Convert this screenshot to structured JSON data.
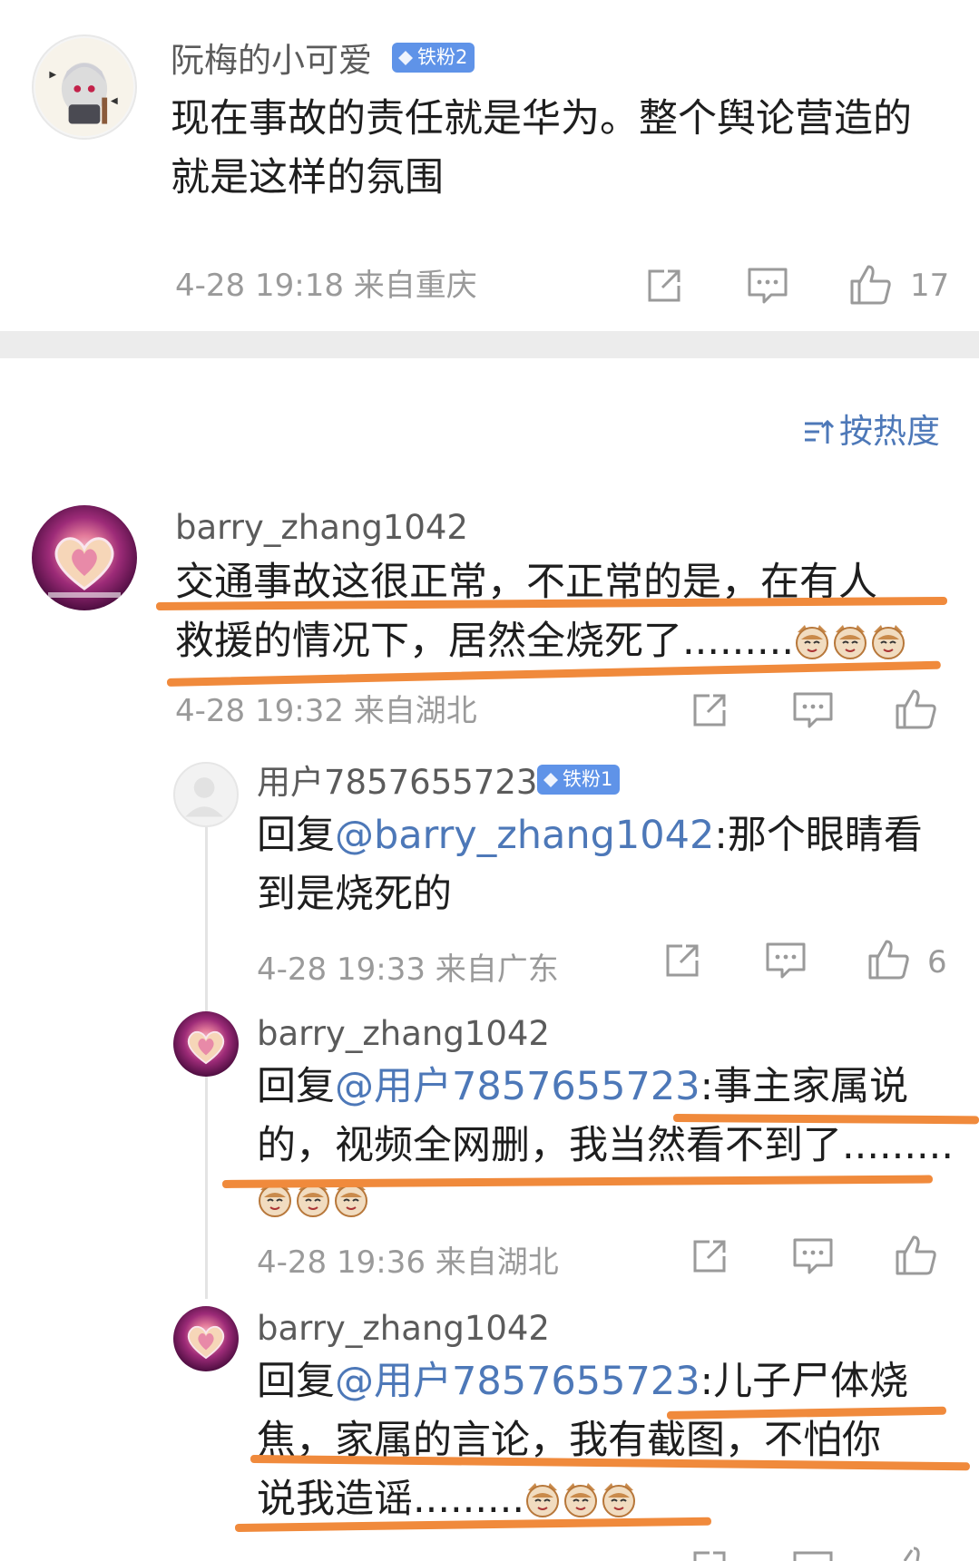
{
  "top_comment": {
    "username": "阮梅的小可爱",
    "badge": "铁粉2",
    "text_line1": "现在事故的责任就是华为。整个舆论营造的",
    "text_line2": "就是这样的氛围",
    "time_location": "4-28 19:18 来自重庆",
    "like_count": "17"
  },
  "sort_label": "按热度",
  "comment": {
    "username": "barry_zhang1042",
    "text_line1": "交通事故这很正常，不正常的是，在有人",
    "text_line2": "救援的情况下，居然全烧死了.........",
    "time_location": "4-28 19:32 来自湖北"
  },
  "replies": [
    {
      "username": "用户7857655723",
      "badge": "铁粉1",
      "reply_prefix": "回复",
      "mention": "@barry_zhang1042",
      "text_line1_rest": ":那个眼睛看",
      "text_line2": "到是烧死的",
      "time_location": "4-28 19:33 来自广东",
      "like_count": "6"
    },
    {
      "username": "barry_zhang1042",
      "reply_prefix": "回复",
      "mention": "@用户7857655723",
      "text_line1_rest": ":事主家属说",
      "text_line2": "的，视频全网删，我当然看不到了.........",
      "time_location": "4-28 19:36 来自湖北"
    },
    {
      "username": "barry_zhang1042",
      "reply_prefix": "回复",
      "mention": "@用户7857655723",
      "text_line1_rest": ":儿子尸体烧",
      "text_line2": "焦，家属的言论，我有截图，不怕你",
      "text_line3": "说我造谣........."
    }
  ],
  "icons": [
    "share-icon",
    "comment-icon",
    "like-icon",
    "sort-icon",
    "diamond-icon",
    "cat-emoji"
  ],
  "colors": {
    "mention": "#4d78b8",
    "badge": "#5f93e8",
    "underline": "#f08a3c",
    "meta": "#9a9a9a"
  }
}
